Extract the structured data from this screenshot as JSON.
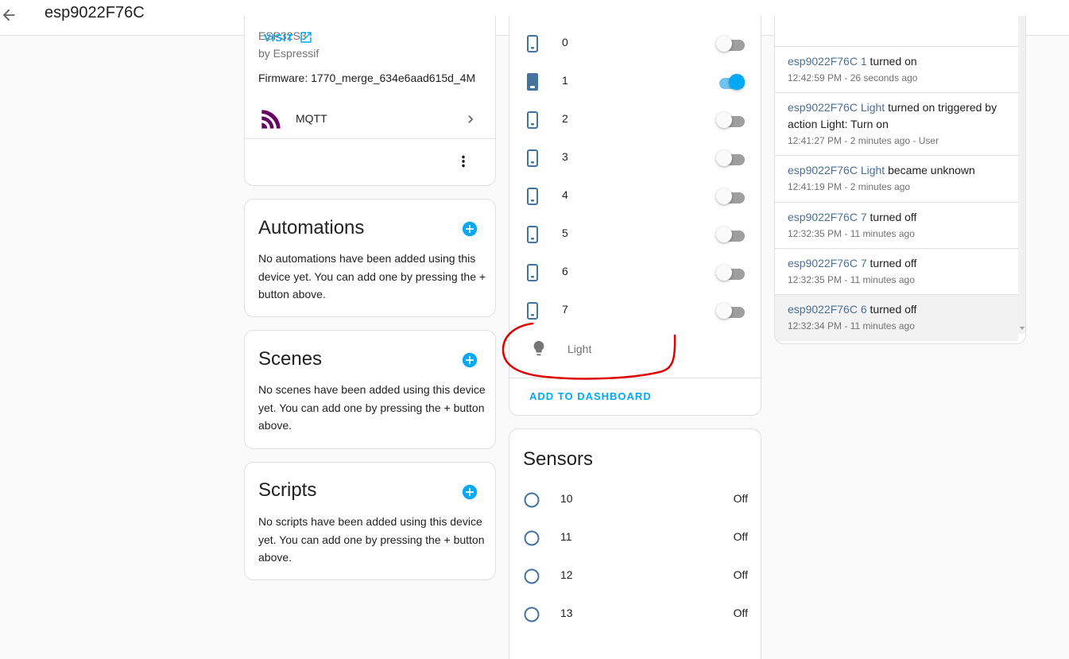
{
  "app": {
    "title": "esp9022F76C"
  },
  "device_info": {
    "model": "ESP32S3",
    "manufacturer": "by Espressif",
    "firmware": "Firmware: 1770_merge_634e6aad615d_4M",
    "integration": "MQTT",
    "visit_label": "VISIT"
  },
  "automations": {
    "title": "Automations",
    "text": "No automations have been added using this device yet. You can add one by pressing the + button above."
  },
  "scenes": {
    "title": "Scenes",
    "text": "No scenes have been added using this device yet. You can add one by pressing the + button above."
  },
  "scripts": {
    "title": "Scripts",
    "text": "No scripts have been added using this device yet. You can add one by pressing the + button above."
  },
  "controls": {
    "items": [
      {
        "label": "0",
        "on": false
      },
      {
        "label": "1",
        "on": true
      },
      {
        "label": "2",
        "on": false
      },
      {
        "label": "3",
        "on": false
      },
      {
        "label": "4",
        "on": false
      },
      {
        "label": "5",
        "on": false
      },
      {
        "label": "6",
        "on": false
      },
      {
        "label": "7",
        "on": false
      }
    ],
    "light_label": "Light",
    "add_to_dashboard": "ADD TO DASHBOARD"
  },
  "sensors": {
    "title": "Sensors",
    "items": [
      {
        "label": "10",
        "value": "Off"
      },
      {
        "label": "11",
        "value": "Off"
      },
      {
        "label": "12",
        "value": "Off"
      },
      {
        "label": "13",
        "value": "Off"
      }
    ]
  },
  "logbook": {
    "entries": [
      {
        "entity": "esp9022F76C 1",
        "action": " turned on",
        "time": "12:42:59 PM - 26 seconds ago"
      },
      {
        "entity": "esp9022F76C Light",
        "action": " turned on triggered by action Light: Turn on",
        "time": "12:41:27 PM - 2 minutes ago - User"
      },
      {
        "entity": "esp9022F76C Light",
        "action": " became unknown",
        "time": "12:41:19 PM - 2 minutes ago"
      },
      {
        "entity": "esp9022F76C 7",
        "action": " turned off",
        "time": "12:32:35 PM - 11 minutes ago"
      },
      {
        "entity": "esp9022F76C 7",
        "action": " turned off",
        "time": "12:32:35 PM - 11 minutes ago"
      },
      {
        "entity": "esp9022F76C 6",
        "action": " turned off",
        "time": "12:32:34 PM - 11 minutes ago"
      }
    ]
  },
  "colors": {
    "accent": "#03a9f4",
    "annotation": "#e00000",
    "entity_icon": "#44739e",
    "mqtt": "#660066"
  },
  "icons": {
    "back": "arrow-left-icon",
    "integration": "mqtt-icon",
    "external": "open-in-new-icon",
    "menu": "dots-vertical-icon",
    "add": "plus-circle-icon",
    "switch": "phone-icon",
    "light": "lightbulb-icon",
    "sensor": "radiobox-blank-icon"
  }
}
